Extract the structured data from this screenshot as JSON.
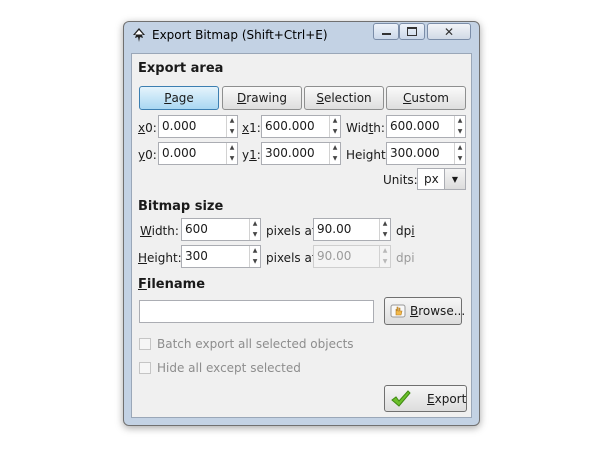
{
  "window": {
    "title": "Export Bitmap (Shift+Ctrl+E)",
    "app_icon": "inkscape-icon",
    "controls": {
      "minimize": "minimize-icon",
      "maximize": "maximize-icon",
      "close": "close-icon"
    }
  },
  "export_area": {
    "heading": "Export area",
    "buttons": [
      {
        "label": "Page",
        "mnemonic": "P",
        "rest": "age",
        "active": true
      },
      {
        "label": "Drawing",
        "mnemonic": "D",
        "rest": "rawing",
        "active": false
      },
      {
        "label": "Selection",
        "mnemonic": "S",
        "rest": "election",
        "active": false
      },
      {
        "label": "Custom",
        "mnemonic": "C",
        "rest": "ustom",
        "active": false
      }
    ],
    "x0": {
      "mnemonic": "x",
      "rest": "0:",
      "value": "0.000"
    },
    "x1": {
      "mnemonic": "x",
      "rest": "1:",
      "value": "600.000"
    },
    "width": {
      "pre": "Wid",
      "mnemonic": "t",
      "post": "h:",
      "value": "600.000"
    },
    "y0": {
      "mnemonic": "y",
      "rest": "0:",
      "value": "0.000"
    },
    "y1": {
      "pre": "y",
      "mnemonic": "1",
      "post": ":",
      "value": "300.000"
    },
    "height": {
      "label": "Height:",
      "value": "300.000"
    },
    "units": {
      "label": "Units:",
      "value": "px"
    }
  },
  "bitmap_size": {
    "heading": "Bitmap size",
    "width": {
      "mnemonic": "W",
      "rest": "idth:",
      "value": "600"
    },
    "height": {
      "mnemonic": "H",
      "rest": "eight:",
      "value": "300"
    },
    "pixels_at": "pixels at",
    "dpi_value": "90.00",
    "dpi_value_disabled": "90.00",
    "dpi": {
      "pre": "dp",
      "mnemonic": "i"
    },
    "dpi_disabled": "dpi"
  },
  "filename": {
    "heading": {
      "mnemonic": "F",
      "rest": "ilename"
    },
    "value": "",
    "browse": {
      "mnemonic": "B",
      "rest": "rowse..."
    },
    "browse_icon": "folder-hand-icon"
  },
  "options": {
    "batch_export": {
      "label": "Batch export all selected objects",
      "checked": false
    },
    "hide_all_except": {
      "label": "Hide all except selected",
      "checked": false
    }
  },
  "export_button": {
    "mnemonic": "E",
    "rest": "xport",
    "icon": "checkmark-icon"
  }
}
